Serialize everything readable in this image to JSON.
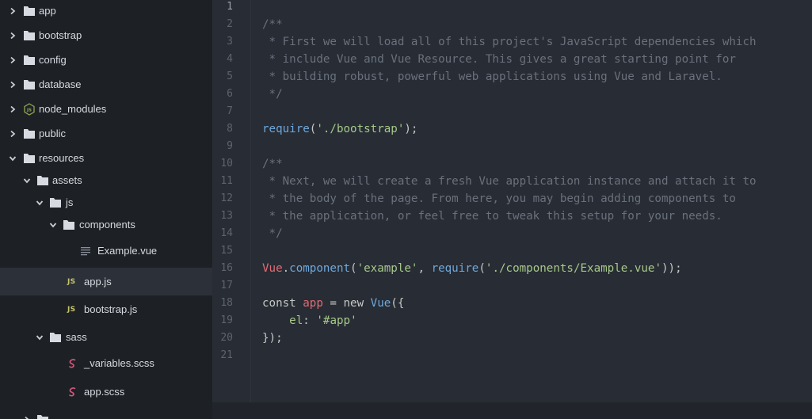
{
  "sidebar": {
    "items": [
      {
        "label": "app",
        "type": "folder",
        "expanded": false
      },
      {
        "label": "bootstrap",
        "type": "folder",
        "expanded": false
      },
      {
        "label": "config",
        "type": "folder",
        "expanded": false
      },
      {
        "label": "database",
        "type": "folder",
        "expanded": false
      },
      {
        "label": "node_modules",
        "type": "node-folder",
        "expanded": false
      },
      {
        "label": "public",
        "type": "folder",
        "expanded": false
      },
      {
        "label": "resources",
        "type": "folder",
        "expanded": true
      },
      {
        "label": "assets",
        "type": "folder",
        "expanded": true
      },
      {
        "label": "js",
        "type": "folder",
        "expanded": true
      },
      {
        "label": "components",
        "type": "folder",
        "expanded": true
      },
      {
        "label": "Example.vue",
        "type": "file"
      },
      {
        "label": "app.js",
        "type": "js-file",
        "selected": true
      },
      {
        "label": "bootstrap.js",
        "type": "js-file"
      },
      {
        "label": "sass",
        "type": "folder",
        "expanded": true
      },
      {
        "label": "_variables.scss",
        "type": "sass-file"
      },
      {
        "label": "app.scss",
        "type": "sass-file"
      }
    ],
    "js_badge": "JS"
  },
  "editor": {
    "line_numbers": [
      "1",
      "2",
      "3",
      "4",
      "5",
      "6",
      "7",
      "8",
      "9",
      "10",
      "11",
      "12",
      "13",
      "14",
      "15",
      "16",
      "17",
      "18",
      "19",
      "20",
      "21"
    ],
    "active_line": 1,
    "lines": [
      [],
      [
        {
          "t": "comment",
          "v": "/**"
        }
      ],
      [
        {
          "t": "comment",
          "v": " * First we will load all of this project's JavaScript dependencies which"
        }
      ],
      [
        {
          "t": "comment",
          "v": " * include Vue and Vue Resource. This gives a great starting point for"
        }
      ],
      [
        {
          "t": "comment",
          "v": " * building robust, powerful web applications using Vue and Laravel."
        }
      ],
      [
        {
          "t": "comment",
          "v": " */"
        }
      ],
      [],
      [
        {
          "t": "fn",
          "v": "require"
        },
        {
          "t": "punc",
          "v": "("
        },
        {
          "t": "str",
          "v": "'./bootstrap'"
        },
        {
          "t": "punc",
          "v": ");"
        }
      ],
      [],
      [
        {
          "t": "comment",
          "v": "/**"
        }
      ],
      [
        {
          "t": "comment",
          "v": " * Next, we will create a fresh Vue application instance and attach it to"
        }
      ],
      [
        {
          "t": "comment",
          "v": " * the body of the page. From here, you may begin adding components to"
        }
      ],
      [
        {
          "t": "comment",
          "v": " * the application, or feel free to tweak this setup for your needs."
        }
      ],
      [
        {
          "t": "comment",
          "v": " */"
        }
      ],
      [],
      [
        {
          "t": "obj",
          "v": "Vue"
        },
        {
          "t": "punc",
          "v": "."
        },
        {
          "t": "fn",
          "v": "component"
        },
        {
          "t": "punc",
          "v": "("
        },
        {
          "t": "str",
          "v": "'example'"
        },
        {
          "t": "punc",
          "v": ", "
        },
        {
          "t": "fn",
          "v": "require"
        },
        {
          "t": "punc",
          "v": "("
        },
        {
          "t": "str",
          "v": "'./components/Example.vue'"
        },
        {
          "t": "punc",
          "v": "));"
        }
      ],
      [],
      [
        {
          "t": "kw",
          "v": "const "
        },
        {
          "t": "var",
          "v": "app"
        },
        {
          "t": "punc",
          "v": " = "
        },
        {
          "t": "kw",
          "v": "new "
        },
        {
          "t": "fn",
          "v": "Vue"
        },
        {
          "t": "punc",
          "v": "({"
        }
      ],
      [
        {
          "t": "punc",
          "v": "    "
        },
        {
          "t": "prop",
          "v": "el"
        },
        {
          "t": "punc",
          "v": ": "
        },
        {
          "t": "str",
          "v": "'#app'"
        }
      ],
      [
        {
          "t": "punc",
          "v": "});"
        }
      ],
      []
    ]
  }
}
